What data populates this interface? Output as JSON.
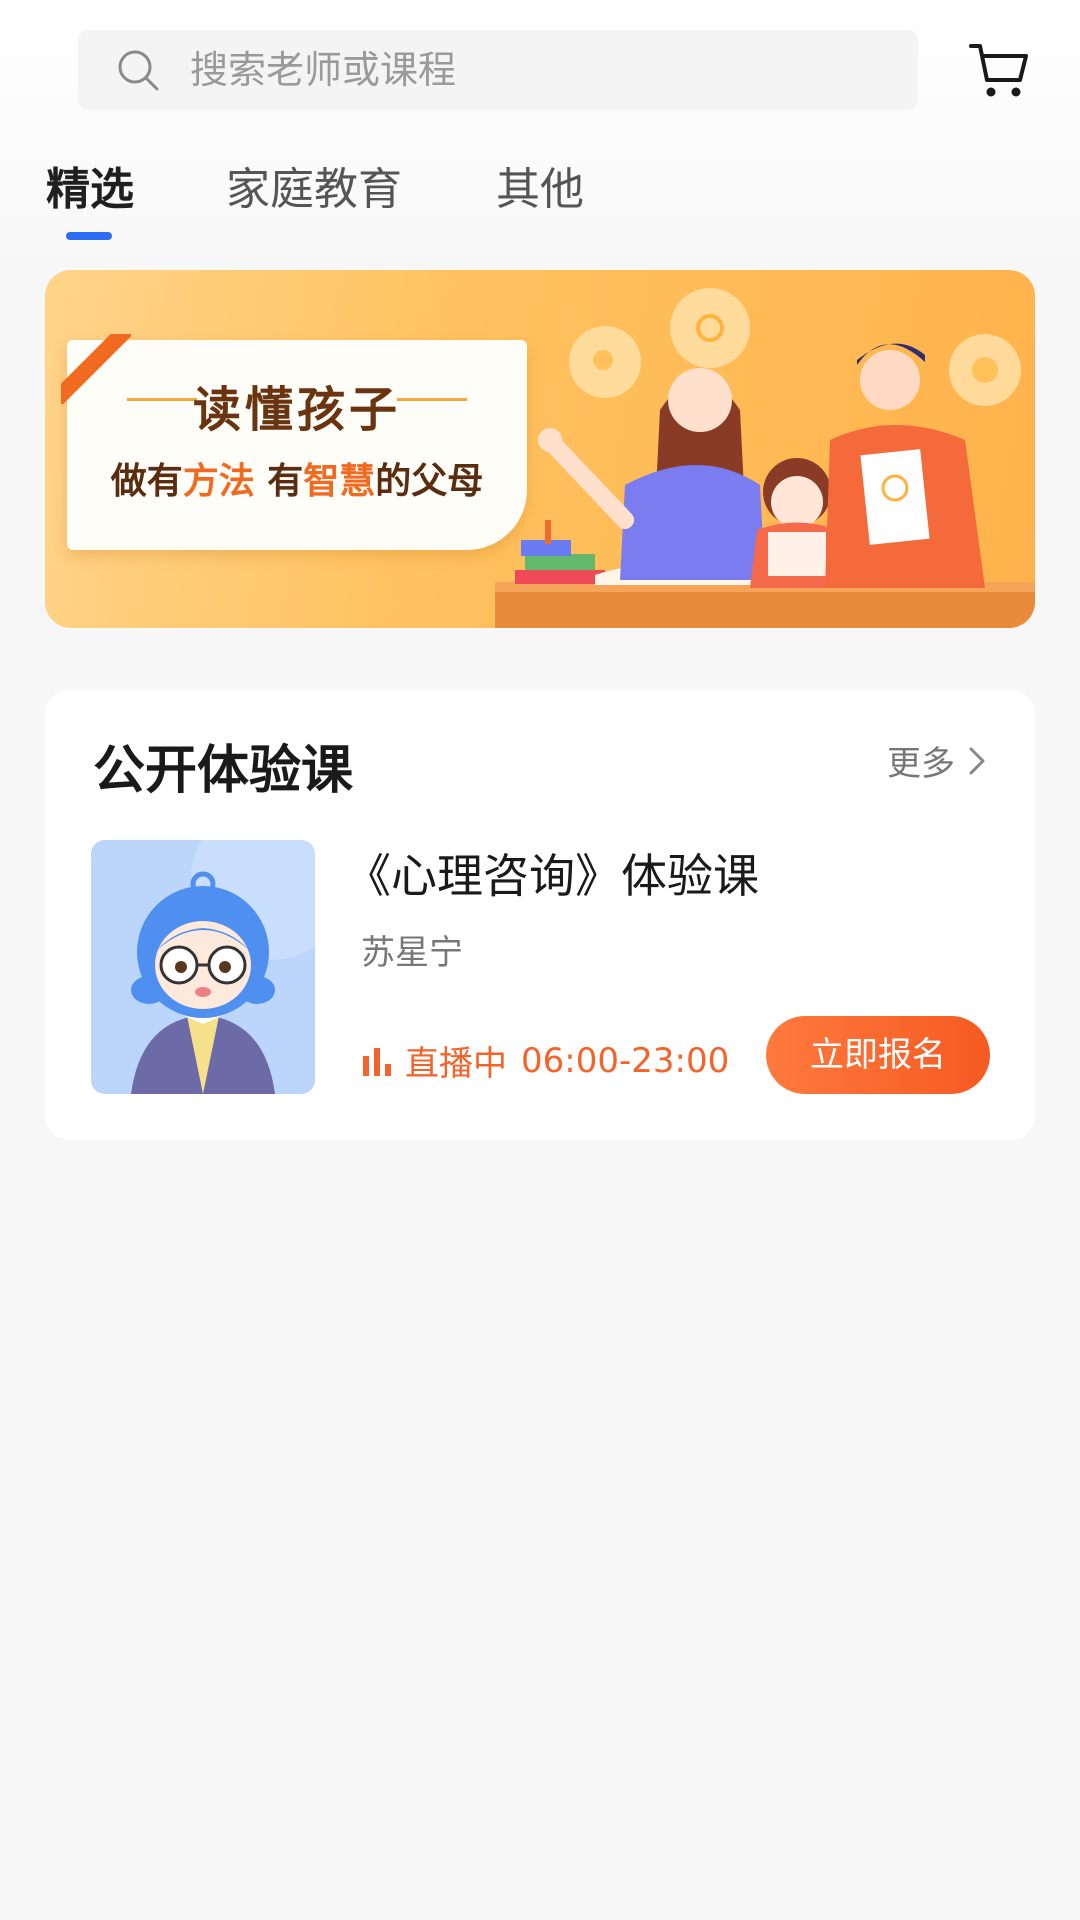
{
  "search": {
    "placeholder": "搜索老师或课程"
  },
  "tabs": [
    {
      "label": "精选",
      "active": true
    },
    {
      "label": "家庭教育",
      "active": false
    },
    {
      "label": "其他",
      "active": false
    }
  ],
  "banner": {
    "title": "读懂孩子",
    "subtitle_parts": [
      "做有",
      "方法",
      " 有",
      "智慧",
      "的父母"
    ]
  },
  "section": {
    "title": "公开体验课",
    "more_label": "更多"
  },
  "course": {
    "title": "《心理咨询》体验课",
    "teacher": "苏星宁",
    "status": "直播中",
    "time": "06:00-23:00",
    "enroll_label": "立即报名"
  },
  "colors": {
    "accent_blue": "#2f6cf6",
    "live_orange": "#f4632a",
    "button_orange": "#f55a22",
    "banner_yellow": "#ffc25f"
  },
  "icons": {
    "search": "search-icon",
    "cart": "cart-icon",
    "more": "chevron-right-icon",
    "live": "live-bars-icon"
  }
}
